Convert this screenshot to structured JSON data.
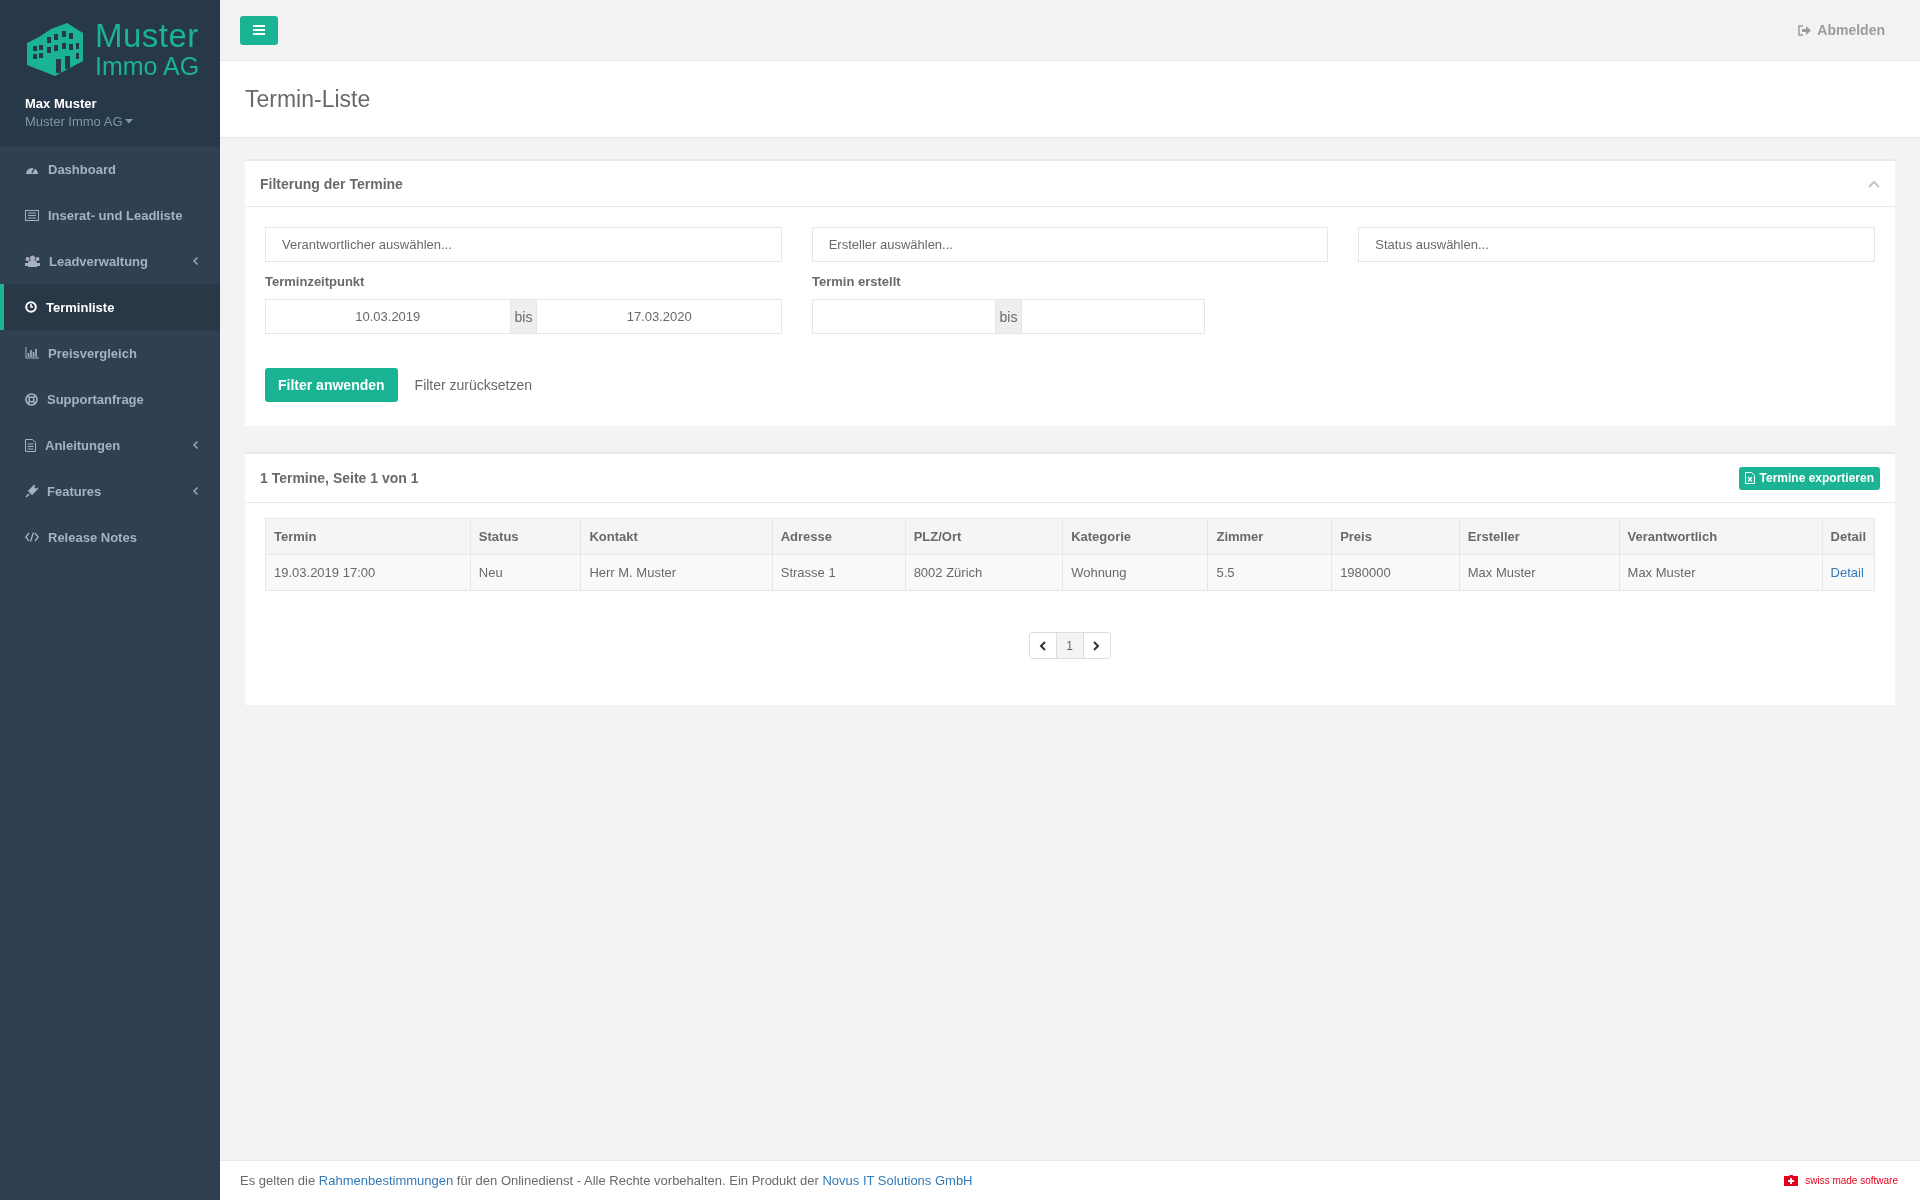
{
  "sidebar": {
    "logo": {
      "line_1": "Muster",
      "line_2": "Immo AG"
    },
    "user": {
      "name": "Max Muster",
      "company": "Muster Immo AG"
    },
    "items": [
      {
        "label": "Dashboard",
        "selected": false,
        "has_submenu": false
      },
      {
        "label": "Inserat- und Leadliste",
        "selected": false,
        "has_submenu": false
      },
      {
        "label": "Leadverwaltung",
        "selected": false,
        "has_submenu": true
      },
      {
        "label": "Terminliste",
        "selected": true,
        "has_submenu": false
      },
      {
        "label": "Preisvergleich",
        "selected": false,
        "has_submenu": false
      },
      {
        "label": "Supportanfrage",
        "selected": false,
        "has_submenu": false
      },
      {
        "label": "Anleitungen",
        "selected": false,
        "has_submenu": true
      },
      {
        "label": "Features",
        "selected": false,
        "has_submenu": true
      },
      {
        "label": "Release Notes",
        "selected": false,
        "has_submenu": false
      }
    ]
  },
  "topbar": {
    "logout": "Abmelden"
  },
  "page_title": "Termin-Liste",
  "filter": {
    "title": "Filterung der Termine",
    "expanded": true,
    "selects": [
      {
        "placeholder": "Verantwortlicher auswählen..."
      },
      {
        "placeholder": "Ersteller auswählen..."
      },
      {
        "placeholder": "Status auswählen..."
      }
    ],
    "ranges": [
      {
        "label": "Terminzeitpunkt",
        "from": "10.03.2019",
        "separator": "bis",
        "to": "17.03.2020"
      },
      {
        "label": "Termin erstellt",
        "separator": "bis"
      }
    ],
    "apply": "Filter anwenden",
    "reset": "Filter zurücksetzen"
  },
  "results": {
    "summary": "1 Termine, Seite 1 von 1",
    "export": "Termine exportieren",
    "table": {
      "columns": [
        "Termin",
        "Status",
        "Kontakt",
        "Adresse",
        "PLZ/Ort",
        "Kategorie",
        "Zimmer",
        "Preis",
        "Ersteller",
        "Verantwortlich",
        "Detail"
      ],
      "rows": [
        {
          "cells": [
            "19.03.2019 17:00",
            "Neu",
            "Herr M. Muster",
            "Strasse 1",
            "8002 Zürich",
            "Wohnung",
            "5.5",
            "1980000",
            "Max Muster",
            "Max Muster"
          ],
          "link": "Detail"
        }
      ]
    },
    "pagination": {
      "pages": [
        {
          "label": "1",
          "selected": true
        }
      ]
    }
  },
  "footer": {
    "parts": [
      {
        "kind": "text",
        "text": "Es gelten die "
      },
      {
        "kind": "link",
        "text": "Rahmenbestimmungen"
      },
      {
        "kind": "text",
        "text": " für den Onlinedienst - Alle Rechte vorbehalten. Ein Produkt der "
      },
      {
        "kind": "link",
        "text": "Novus IT Solutions GmbH"
      }
    ],
    "badge": "swiss made software"
  }
}
